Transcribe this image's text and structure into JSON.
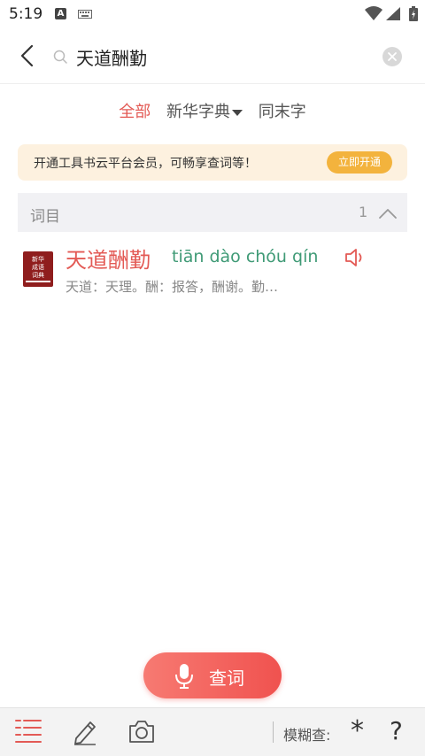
{
  "status_bar": {
    "time": "5:19",
    "a_badge": "A"
  },
  "search": {
    "query": "天道酬勤"
  },
  "filters": [
    {
      "label": "全部",
      "active": true
    },
    {
      "label": "新华字典",
      "active": false
    },
    {
      "label": "同末字",
      "active": false
    }
  ],
  "banner": {
    "text": "开通工具书云平台会员，可畅享查词等！",
    "button": "立即开通"
  },
  "section": {
    "title": "词目",
    "count": "1"
  },
  "result": {
    "book_line1": "新华",
    "book_line2": "成语",
    "book_line3": "词典",
    "word": "天道酬勤",
    "pinyin": "tiān dào chóu qín",
    "definition": "天道：天理。酬：报答，酬谢。勤…"
  },
  "query_button": {
    "label": "查词"
  },
  "toolbar": {
    "fuzzy_label": "模糊查:",
    "star": "*",
    "question": "?"
  },
  "colors": {
    "accent": "#e35a55",
    "pinyin": "#3f9a76",
    "banner_bg": "#fdf1df",
    "banner_btn": "#f3b33d"
  }
}
